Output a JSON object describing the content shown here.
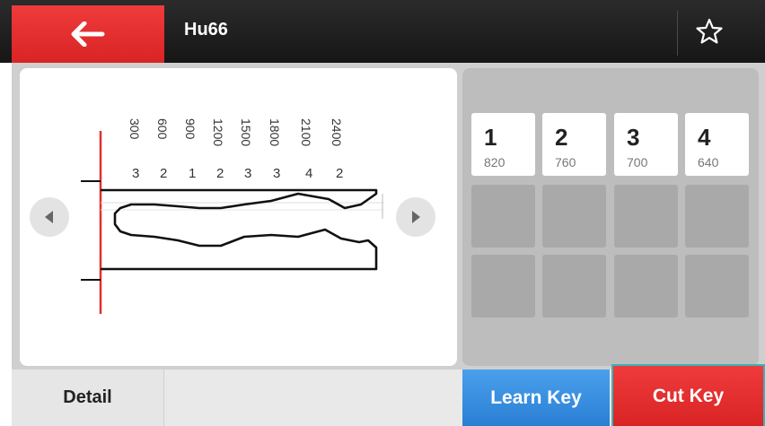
{
  "header": {
    "title": "Hu66",
    "back_icon": "arrow-left-icon",
    "favorite_icon": "star-outline-icon"
  },
  "key_view": {
    "positions": [
      "300",
      "600",
      "900",
      "1200",
      "1500",
      "1800",
      "2100",
      "2400"
    ],
    "depths": [
      "3",
      "2",
      "1",
      "2",
      "3",
      "3",
      "4",
      "2"
    ],
    "prev_icon": "triangle-left-icon",
    "next_icon": "triangle-right-icon"
  },
  "cuts": [
    {
      "number": "1",
      "value": "820"
    },
    {
      "number": "2",
      "value": "760"
    },
    {
      "number": "3",
      "value": "700"
    },
    {
      "number": "4",
      "value": "640"
    }
  ],
  "buttons": {
    "detail": "Detail",
    "learn_key": "Learn Key",
    "cut_key": "Cut Key"
  },
  "colors": {
    "accent_red": "#e0302f",
    "learn_blue": "#3a8fe0",
    "header_dark": "#1f1f1f",
    "highlight_teal": "#38b3b8"
  }
}
